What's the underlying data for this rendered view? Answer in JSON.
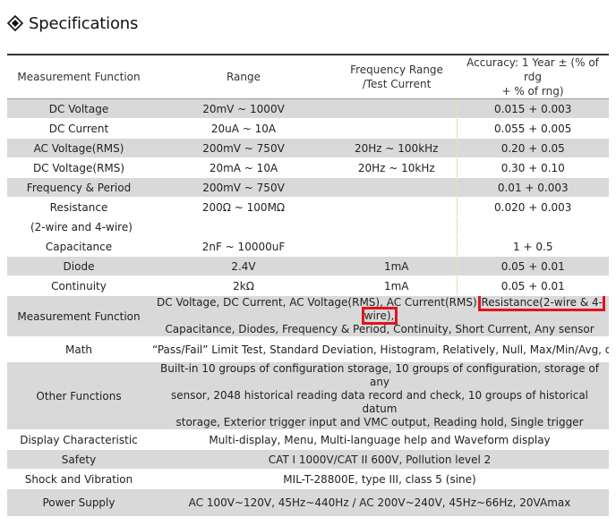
{
  "page": {
    "title": "Specifications",
    "header": {
      "function": "Measurement Function",
      "range": "Range",
      "freq_line1": "Frequency Range",
      "freq_line2": "/Test Current",
      "acc_line1": "Accuracy: 1 Year ± (% of rdg",
      "acc_line2": "+ % of rng)"
    },
    "rows": [
      {
        "function": "DC Voltage",
        "range": "20mV ~ 1000V",
        "freq": "",
        "accuracy": "0.015 + 0.003"
      },
      {
        "function": "DC Current",
        "range": "20uA ~ 10A",
        "freq": "",
        "accuracy": "0.055 + 0.005"
      },
      {
        "function": "AC Voltage(RMS)",
        "range": "200mV ~ 750V",
        "freq": "20Hz ~ 100kHz",
        "accuracy": "0.20 + 0.05"
      },
      {
        "function": "DC Voltage(RMS)",
        "range": "20mA ~ 10A",
        "freq": "20Hz ~ 10kHz",
        "accuracy": "0.30 + 0.10"
      },
      {
        "function": "Frequency & Period",
        "range": "200mV ~ 750V",
        "freq": "",
        "accuracy": "0.01 + 0.003"
      },
      {
        "function": "Resistance",
        "range": "200Ω ~ 100MΩ",
        "freq": "",
        "accuracy": "0.020 + 0.003"
      },
      {
        "function": "(2-wire and 4-wire)",
        "range": "",
        "freq": "",
        "accuracy": ""
      },
      {
        "function": "Capacitance",
        "range": "2nF ~ 10000uF",
        "freq": "",
        "accuracy": "1 + 0.5"
      },
      {
        "function": "Diode",
        "range": "2.4V",
        "freq": "1mA",
        "accuracy": "0.05 + 0.01"
      },
      {
        "function": "Continuity",
        "range": "2kΩ",
        "freq": "1mA",
        "accuracy": "0.05 + 0.01"
      }
    ],
    "measurement_function": {
      "label": "Measurement Function",
      "line1_a": "DC Voltage, DC Current, AC Voltage(RMS), AC Current(RMS)",
      "line1_highlight": "Resistance(2-wire & 4-wire),",
      "line2": "Capacitance, Diodes, Frequency & Period, Continuity, Short Current, Any sensor"
    },
    "math": {
      "label": "Math",
      "value": "“Pass/Fail” Limit Test, Standard Deviation, Histogram, Relatively, Null, Max/Min/Avg, dBm, dB"
    },
    "other_functions": {
      "label": "Other Functions",
      "line1": "Built-in 10 groups of configuration storage, 10 groups of configuration, storage of any",
      "line2": "sensor, 2048 historical reading data record and check, 10 groups of historical datum",
      "line3": "storage, Exterior trigger input and VMC output, Reading hold, Single trigger"
    },
    "display": {
      "label": "Display Characteristic",
      "value": "Multi-display, Menu, Multi-language help and Waveform display"
    },
    "safety": {
      "label": "Safety",
      "value": "CAT I 1000V/CAT II 600V, Pollution level 2"
    },
    "shock": {
      "label": "Shock and Vibration",
      "value": "MIL-T-28800E, type III, class 5 (sine)"
    },
    "power": {
      "label": "Power Supply",
      "value": "AC 100V~120V, 45Hz~440Hz / AC 200V~240V, 45Hz~66Hz, 20VAmax"
    }
  },
  "colors": {
    "band": "#d9d9d9",
    "highlight_box": "#e0141c"
  },
  "icons": {
    "title_bullet": "diamond-bullet-icon"
  }
}
